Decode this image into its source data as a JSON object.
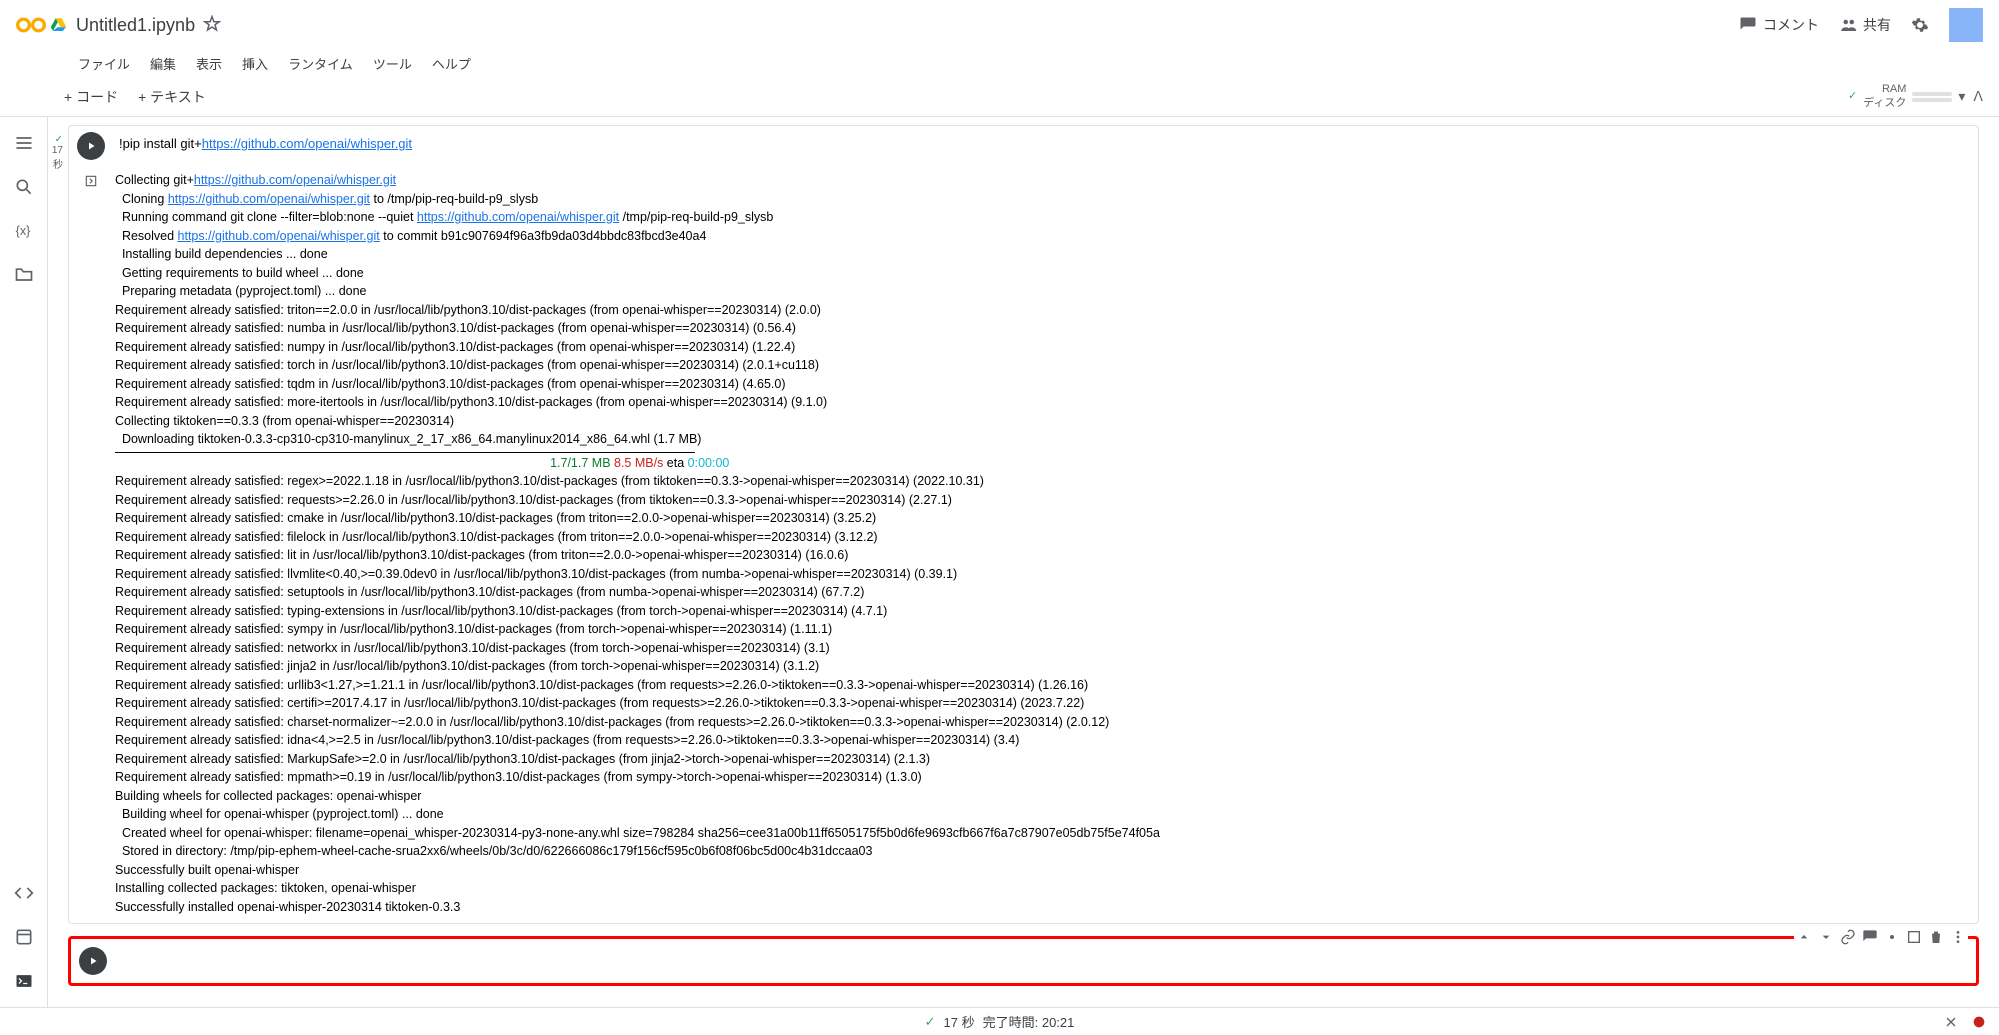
{
  "header": {
    "title": "Untitled1.ipynb",
    "comment": "コメント",
    "share": "共有"
  },
  "menu": {
    "file": "ファイル",
    "edit": "編集",
    "view": "表示",
    "insert": "挿入",
    "runtime": "ランタイム",
    "tools": "ツール",
    "help": "ヘルプ"
  },
  "toolbar": {
    "code": "+ コード",
    "text": "+ テキスト",
    "ram": "RAM",
    "disk": "ディスク"
  },
  "cell1": {
    "status_time": "17",
    "status_unit": "秒",
    "code_prefix": "!pip install git+",
    "code_link": "https://github.com/openai/whisper.git",
    "output": {
      "l1_a": "Collecting git+",
      "l1_link": "https://github.com/openai/whisper.git",
      "l2_a": "  Cloning ",
      "l2_link": "https://github.com/openai/whisper.git",
      "l2_b": " to /tmp/pip-req-build-p9_slysb",
      "l3_a": "  Running command git clone --filter=blob:none --quiet ",
      "l3_link": "https://github.com/openai/whisper.git",
      "l3_b": " /tmp/pip-req-build-p9_slysb",
      "l4_a": "  Resolved ",
      "l4_link": "https://github.com/openai/whisper.git",
      "l4_b": " to commit b91c907694f96a3fb9da03d4bbdc83fbcd3e40a4",
      "l5": "  Installing build dependencies ... done",
      "l6": "  Getting requirements to build wheel ... done",
      "l7": "  Preparing metadata (pyproject.toml) ... done",
      "l8": "Requirement already satisfied: triton==2.0.0 in /usr/local/lib/python3.10/dist-packages (from openai-whisper==20230314) (2.0.0)",
      "l9": "Requirement already satisfied: numba in /usr/local/lib/python3.10/dist-packages (from openai-whisper==20230314) (0.56.4)",
      "l10": "Requirement already satisfied: numpy in /usr/local/lib/python3.10/dist-packages (from openai-whisper==20230314) (1.22.4)",
      "l11": "Requirement already satisfied: torch in /usr/local/lib/python3.10/dist-packages (from openai-whisper==20230314) (2.0.1+cu118)",
      "l12": "Requirement already satisfied: tqdm in /usr/local/lib/python3.10/dist-packages (from openai-whisper==20230314) (4.65.0)",
      "l13": "Requirement already satisfied: more-itertools in /usr/local/lib/python3.10/dist-packages (from openai-whisper==20230314) (9.1.0)",
      "l14": "Collecting tiktoken==0.3.3 (from openai-whisper==20230314)",
      "l15": "  Downloading tiktoken-0.3.3-cp310-cp310-manylinux_2_17_x86_64.manylinux2014_x86_64.whl (1.7 MB)",
      "l16_a": "1.7/1.7 MB",
      "l16_b": " 8.5 MB/s",
      "l16_c": " eta ",
      "l16_d": "0:00:00",
      "l17": "Requirement already satisfied: regex>=2022.1.18 in /usr/local/lib/python3.10/dist-packages (from tiktoken==0.3.3->openai-whisper==20230314) (2022.10.31)",
      "l18": "Requirement already satisfied: requests>=2.26.0 in /usr/local/lib/python3.10/dist-packages (from tiktoken==0.3.3->openai-whisper==20230314) (2.27.1)",
      "l19": "Requirement already satisfied: cmake in /usr/local/lib/python3.10/dist-packages (from triton==2.0.0->openai-whisper==20230314) (3.25.2)",
      "l20": "Requirement already satisfied: filelock in /usr/local/lib/python3.10/dist-packages (from triton==2.0.0->openai-whisper==20230314) (3.12.2)",
      "l21": "Requirement already satisfied: lit in /usr/local/lib/python3.10/dist-packages (from triton==2.0.0->openai-whisper==20230314) (16.0.6)",
      "l22": "Requirement already satisfied: llvmlite<0.40,>=0.39.0dev0 in /usr/local/lib/python3.10/dist-packages (from numba->openai-whisper==20230314) (0.39.1)",
      "l23": "Requirement already satisfied: setuptools in /usr/local/lib/python3.10/dist-packages (from numba->openai-whisper==20230314) (67.7.2)",
      "l24": "Requirement already satisfied: typing-extensions in /usr/local/lib/python3.10/dist-packages (from torch->openai-whisper==20230314) (4.7.1)",
      "l25": "Requirement already satisfied: sympy in /usr/local/lib/python3.10/dist-packages (from torch->openai-whisper==20230314) (1.11.1)",
      "l26": "Requirement already satisfied: networkx in /usr/local/lib/python3.10/dist-packages (from torch->openai-whisper==20230314) (3.1)",
      "l27": "Requirement already satisfied: jinja2 in /usr/local/lib/python3.10/dist-packages (from torch->openai-whisper==20230314) (3.1.2)",
      "l28": "Requirement already satisfied: urllib3<1.27,>=1.21.1 in /usr/local/lib/python3.10/dist-packages (from requests>=2.26.0->tiktoken==0.3.3->openai-whisper==20230314) (1.26.16)",
      "l29": "Requirement already satisfied: certifi>=2017.4.17 in /usr/local/lib/python3.10/dist-packages (from requests>=2.26.0->tiktoken==0.3.3->openai-whisper==20230314) (2023.7.22)",
      "l30": "Requirement already satisfied: charset-normalizer~=2.0.0 in /usr/local/lib/python3.10/dist-packages (from requests>=2.26.0->tiktoken==0.3.3->openai-whisper==20230314) (2.0.12)",
      "l31": "Requirement already satisfied: idna<4,>=2.5 in /usr/local/lib/python3.10/dist-packages (from requests>=2.26.0->tiktoken==0.3.3->openai-whisper==20230314) (3.4)",
      "l32": "Requirement already satisfied: MarkupSafe>=2.0 in /usr/local/lib/python3.10/dist-packages (from jinja2->torch->openai-whisper==20230314) (2.1.3)",
      "l33": "Requirement already satisfied: mpmath>=0.19 in /usr/local/lib/python3.10/dist-packages (from sympy->torch->openai-whisper==20230314) (1.3.0)",
      "l34": "Building wheels for collected packages: openai-whisper",
      "l35": "  Building wheel for openai-whisper (pyproject.toml) ... done",
      "l36": "  Created wheel for openai-whisper: filename=openai_whisper-20230314-py3-none-any.whl size=798284 sha256=cee31a00b11ff6505175f5b0d6fe9693cfb667f6a7c87907e05db75f5e74f05a",
      "l37": "  Stored in directory: /tmp/pip-ephem-wheel-cache-srua2xx6/wheels/0b/3c/d0/622666086c179f156cf595c0b6f08f06bc5d00c4b31dccaa03",
      "l38": "Successfully built openai-whisper",
      "l39": "Installing collected packages: tiktoken, openai-whisper",
      "l40": "Successfully installed openai-whisper-20230314 tiktoken-0.3.3"
    }
  },
  "statusbar": {
    "time": "17 秒",
    "completed": "完了時間: 20:21"
  }
}
